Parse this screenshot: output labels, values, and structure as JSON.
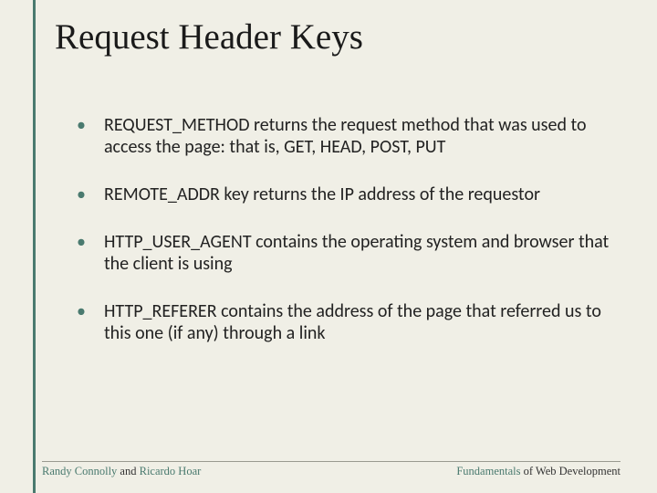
{
  "title": "Request Header Keys",
  "bullets": [
    "REQUEST_METHOD returns the request method that was used to access the page: that is, GET, HEAD, POST, PUT",
    "REMOTE_ADDR key returns the IP address of the requestor",
    "HTTP_USER_AGENT contains the operating system and browser that the client is using",
    "HTTP_REFERER contains the address of the page that referred us to this one (if any) through a link"
  ],
  "footer": {
    "left": {
      "author1": "Randy Connolly",
      "connector": " and ",
      "author2": "Ricardo Hoar"
    },
    "right": {
      "word1": "Fundamentals",
      "rest": " of Web Development"
    }
  }
}
